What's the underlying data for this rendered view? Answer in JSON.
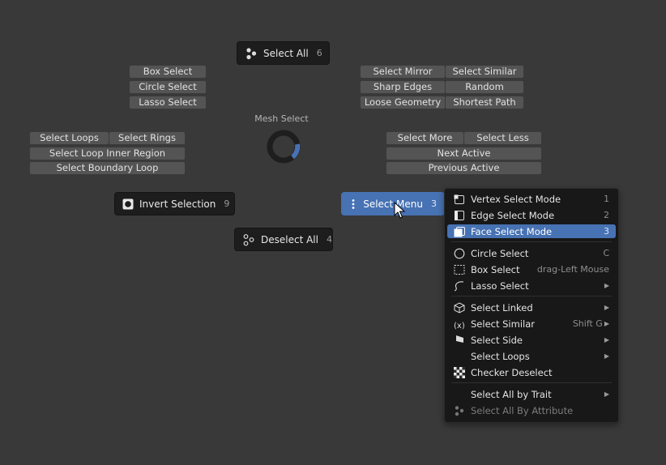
{
  "pie": {
    "title": "Mesh Select",
    "select_all": {
      "label": "Select All",
      "num": "6"
    },
    "invert": {
      "label": "Invert Selection",
      "num": "9"
    },
    "deselect": {
      "label": "Deselect All",
      "num": "4"
    },
    "select_menu": {
      "label": "Select Menu",
      "num": "3"
    },
    "left_group": [
      "Box Select",
      "Circle Select",
      "Lasso Select"
    ],
    "right_group": [
      [
        "Select Mirror",
        "Select Similar"
      ],
      [
        "Sharp Edges",
        "Random"
      ],
      [
        "Loose Geometry",
        "Shortest Path"
      ]
    ],
    "loops_group": {
      "row1": [
        "Select Loops",
        "Select Rings"
      ],
      "row2": "Select Loop Inner Region",
      "row3": "Select Boundary Loop"
    },
    "more_group": {
      "row1": [
        "Select More",
        "Select Less"
      ],
      "row2": "Next Active",
      "row3": "Previous Active"
    }
  },
  "menu": {
    "items": [
      {
        "label": "Vertex Select Mode",
        "shortcut": "1",
        "icon": "vertex-mode-icon"
      },
      {
        "label": "Edge Select Mode",
        "shortcut": "2",
        "icon": "edge-mode-icon"
      },
      {
        "label": "Face Select Mode",
        "shortcut": "3",
        "icon": "face-mode-icon"
      },
      {
        "label": "Circle Select",
        "shortcut": "C",
        "icon": "circle-select-icon"
      },
      {
        "label": "Box Select",
        "shortcut": "drag-Left Mouse",
        "icon": "box-select-icon"
      },
      {
        "label": "Lasso Select",
        "icon": "lasso-select-icon"
      },
      {
        "label": "Select Linked",
        "icon": "cube-icon"
      },
      {
        "label": "Select Similar",
        "shortcut": "Shift G",
        "icon": "similar-icon"
      },
      {
        "label": "Select Side",
        "icon": "flag-icon"
      },
      {
        "label": "Select Loops"
      },
      {
        "label": "Checker Deselect",
        "icon": "checker-icon"
      },
      {
        "label": "Select All by Trait"
      },
      {
        "label": "Select All By Attribute",
        "icon": "attribute-icon"
      }
    ]
  },
  "colors": {
    "accent": "#4772b3",
    "background": "#393939"
  }
}
